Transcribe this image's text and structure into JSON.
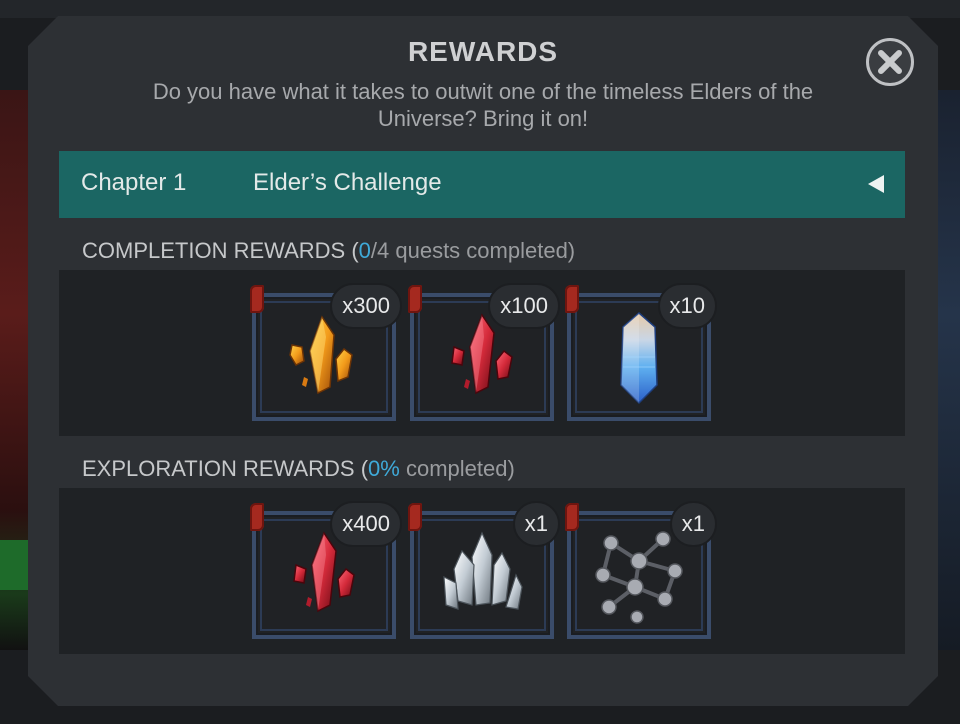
{
  "modal": {
    "title": "REWARDS",
    "subtitle": "Do you have what it takes to outwit one of the timeless Elders of the Universe? Bring it on!"
  },
  "chapter": {
    "number_label": "Chapter 1",
    "name": "Elder’s Challenge"
  },
  "completion": {
    "label": "COMPLETION REWARDS (",
    "done": "0",
    "rest": "/4 quests completed)",
    "rewards": [
      {
        "icon": "gold-crystal-shards-icon",
        "count": "x300",
        "color": "#e8911a"
      },
      {
        "icon": "red-crystal-shards-icon",
        "count": "x100",
        "color": "#d42a3a"
      },
      {
        "icon": "blue-crystal-icon",
        "count": "x10",
        "color": "#4aa8e8"
      }
    ]
  },
  "exploration": {
    "label": "EXPLORATION REWARDS (",
    "percent": "0%",
    "rest": " completed)",
    "rewards": [
      {
        "icon": "red-crystal-shards-icon",
        "count": "x400",
        "color": "#d42a3a"
      },
      {
        "icon": "clear-crystal-cluster-icon",
        "count": "x1",
        "color": "#cfd6dc"
      },
      {
        "icon": "molecule-catalyst-icon",
        "count": "x1",
        "color": "#8c8f96"
      }
    ]
  },
  "colors": {
    "accent_teal": "#1b6663",
    "highlight_blue": "#3fa9d8",
    "panel": "#2d3034"
  }
}
